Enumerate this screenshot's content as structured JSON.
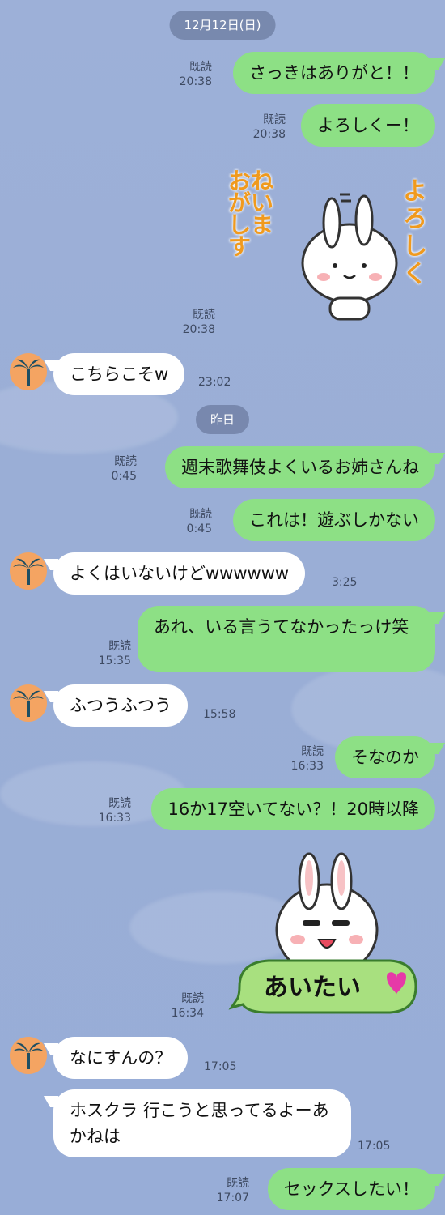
{
  "colors": {
    "background": "#9aaed6",
    "sent_bubble": "#8de085",
    "received_bubble": "#ffffff",
    "avatar_bg": "#f4a462"
  },
  "dates": {
    "first": "12月12日(日)",
    "second": "昨日"
  },
  "messages": [
    {
      "id": "m1",
      "dir": "sent",
      "text": "さっきはありがと！！",
      "read": "既読",
      "time": "20:38"
    },
    {
      "id": "m2",
      "dir": "sent",
      "text": "よろしくー！",
      "read": "既読",
      "time": "20:38"
    },
    {
      "id": "m3",
      "dir": "sent",
      "type": "sticker",
      "sticker_icon": "bunny-yoroshiku-sticker",
      "sticker_text_right": "よろしく",
      "sticker_text_left": "おねがいします",
      "read": "既読",
      "time": "20:38"
    },
    {
      "id": "m4",
      "dir": "recv",
      "text": "こちらこそw",
      "time": "23:02"
    },
    {
      "id": "m5",
      "dir": "sent",
      "text": "週末歌舞伎よくいるお姉さんね",
      "read": "既読",
      "time": "0:45"
    },
    {
      "id": "m6",
      "dir": "sent",
      "text": "これは！遊ぶしかない",
      "read": "既読",
      "time": "0:45"
    },
    {
      "id": "m7",
      "dir": "recv",
      "text": "よくはいないけどwwwwww",
      "time": "3:25"
    },
    {
      "id": "m8",
      "dir": "sent",
      "text": "あれ、いる言うてなかったっけ笑",
      "read": "既読",
      "time": "15:35"
    },
    {
      "id": "m9",
      "dir": "recv",
      "text": "ふつうふつう",
      "time": "15:58"
    },
    {
      "id": "m10",
      "dir": "sent",
      "text": "そなのか",
      "read": "既読",
      "time": "16:33"
    },
    {
      "id": "m11",
      "dir": "sent",
      "text": "16か17空いてない？！20時以降",
      "read": "既読",
      "time": "16:33"
    },
    {
      "id": "m12",
      "dir": "sent",
      "type": "sticker",
      "sticker_icon": "bunny-aitai-sticker",
      "sticker_text": "あいたい",
      "read": "既読",
      "time": "16:34"
    },
    {
      "id": "m13",
      "dir": "recv",
      "text": "なにすんの？",
      "time": "17:05"
    },
    {
      "id": "m14",
      "dir": "recv",
      "text": "ホスクラ 行こうと思ってるよーあかねは",
      "time": "17:05"
    },
    {
      "id": "m15",
      "dir": "sent",
      "text": "セックスしたい！",
      "read": "既読",
      "time": "17:07"
    }
  ],
  "avatar_icon": "palm-tree-icon"
}
